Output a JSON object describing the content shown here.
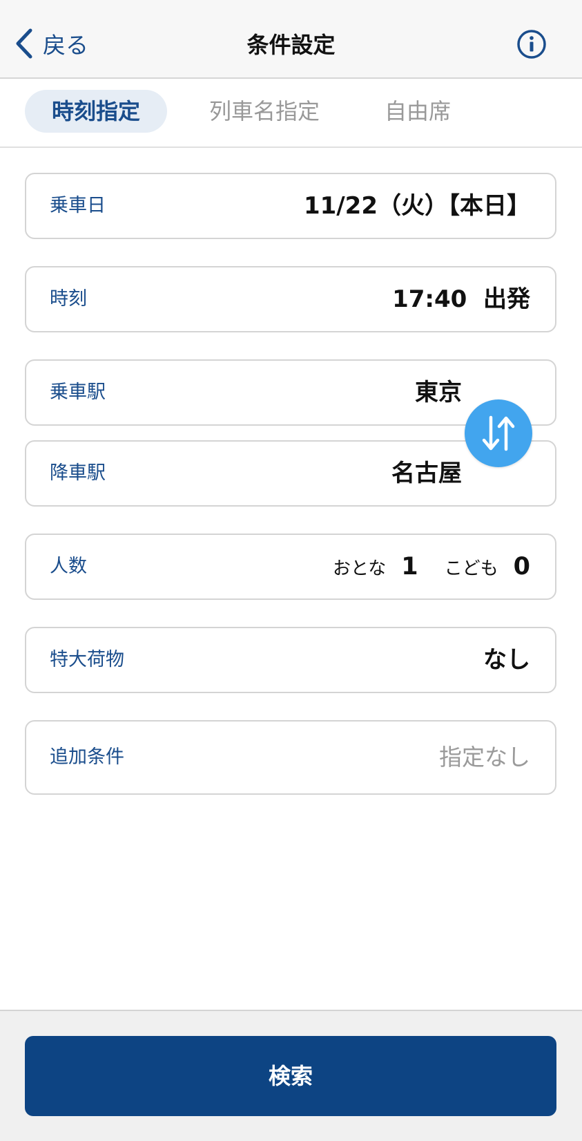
{
  "header": {
    "back_label": "戻る",
    "title": "条件設定"
  },
  "tabs": [
    {
      "label": "時刻指定",
      "active": true
    },
    {
      "label": "列車名指定",
      "active": false
    },
    {
      "label": "自由席",
      "active": false
    }
  ],
  "form": {
    "date": {
      "label": "乗車日",
      "value": "11/22（火）【本日】"
    },
    "time": {
      "label": "時刻",
      "value": "17:40  出発"
    },
    "departure": {
      "label": "乗車駅",
      "value": "東京"
    },
    "arrival": {
      "label": "降車駅",
      "value": "名古屋"
    },
    "passengers": {
      "label": "人数",
      "adult_label": "おとな",
      "adult_count": "1",
      "child_label": "こども",
      "child_count": "0"
    },
    "luggage": {
      "label": "特大荷物",
      "value": "なし"
    },
    "extra": {
      "label": "追加条件",
      "value": "指定なし"
    }
  },
  "search_button": "検索",
  "icons": {
    "back": "chevron-left-icon",
    "info": "info-icon",
    "swap": "swap-arrows-icon"
  },
  "colors": {
    "primary": "#0d4483",
    "accent": "#42a5ee",
    "label": "#1a4d8c"
  }
}
